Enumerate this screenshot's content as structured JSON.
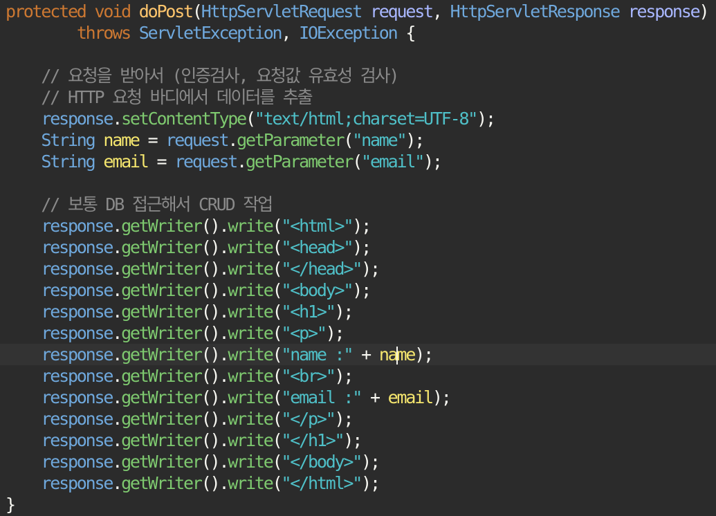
{
  "editor": {
    "colors": {
      "background": "#2b2b2b",
      "keyword": "#cc7832",
      "method_decl": "#ffc66d",
      "type": "#6fa8dc",
      "param": "#a9b7ff",
      "comment": "#8a8a8a",
      "method": "#7ec96f",
      "string": "#4fc0c8",
      "variable": "#f5e66e"
    },
    "current_line": 16,
    "lines": [
      [
        {
          "t": "protected",
          "c": "kw"
        },
        {
          "t": " ",
          "c": "punc"
        },
        {
          "t": "void",
          "c": "kw"
        },
        {
          "t": " ",
          "c": "punc"
        },
        {
          "t": "doPost",
          "c": "method-decl"
        },
        {
          "t": "(",
          "c": "punc"
        },
        {
          "t": "HttpServletRequest",
          "c": "type"
        },
        {
          "t": " ",
          "c": "punc"
        },
        {
          "t": "request",
          "c": "param"
        },
        {
          "t": ", ",
          "c": "punc"
        },
        {
          "t": "HttpServletResponse",
          "c": "type"
        },
        {
          "t": " ",
          "c": "punc"
        },
        {
          "t": "response",
          "c": "param"
        },
        {
          "t": ")",
          "c": "punc"
        }
      ],
      [
        {
          "t": "        ",
          "c": "punc"
        },
        {
          "t": "throws",
          "c": "kw"
        },
        {
          "t": " ",
          "c": "punc"
        },
        {
          "t": "ServletException",
          "c": "type"
        },
        {
          "t": ", ",
          "c": "punc"
        },
        {
          "t": "IOException",
          "c": "type"
        },
        {
          "t": " {",
          "c": "punc"
        }
      ],
      [],
      [
        {
          "t": "    ",
          "c": "punc"
        },
        {
          "t": "// 요청을 받아서 (인증검사, 요청값 유효성 검사)",
          "c": "comment"
        }
      ],
      [
        {
          "t": "    ",
          "c": "punc"
        },
        {
          "t": "// HTTP 요청 바디에서 데이터를 추출",
          "c": "comment"
        }
      ],
      [
        {
          "t": "    ",
          "c": "punc"
        },
        {
          "t": "response",
          "c": "obj"
        },
        {
          "t": ".",
          "c": "punc"
        },
        {
          "t": "setContentType",
          "c": "method"
        },
        {
          "t": "(",
          "c": "punc"
        },
        {
          "t": "\"text/html;charset=UTF-8\"",
          "c": "string"
        },
        {
          "t": ");",
          "c": "punc"
        }
      ],
      [
        {
          "t": "    ",
          "c": "punc"
        },
        {
          "t": "String",
          "c": "type"
        },
        {
          "t": " ",
          "c": "punc"
        },
        {
          "t": "name",
          "c": "var"
        },
        {
          "t": " = ",
          "c": "op"
        },
        {
          "t": "request",
          "c": "obj"
        },
        {
          "t": ".",
          "c": "punc"
        },
        {
          "t": "getParameter",
          "c": "method"
        },
        {
          "t": "(",
          "c": "punc"
        },
        {
          "t": "\"name\"",
          "c": "string"
        },
        {
          "t": ");",
          "c": "punc"
        }
      ],
      [
        {
          "t": "    ",
          "c": "punc"
        },
        {
          "t": "String",
          "c": "type"
        },
        {
          "t": " ",
          "c": "punc"
        },
        {
          "t": "email",
          "c": "var"
        },
        {
          "t": " = ",
          "c": "op"
        },
        {
          "t": "request",
          "c": "obj"
        },
        {
          "t": ".",
          "c": "punc"
        },
        {
          "t": "getParameter",
          "c": "method"
        },
        {
          "t": "(",
          "c": "punc"
        },
        {
          "t": "\"email\"",
          "c": "string"
        },
        {
          "t": ");",
          "c": "punc"
        }
      ],
      [],
      [
        {
          "t": "    ",
          "c": "punc"
        },
        {
          "t": "// 보통 DB 접근해서 CRUD 작업",
          "c": "comment"
        }
      ],
      [
        {
          "t": "    ",
          "c": "punc"
        },
        {
          "t": "response",
          "c": "obj"
        },
        {
          "t": ".",
          "c": "punc"
        },
        {
          "t": "getWriter",
          "c": "method"
        },
        {
          "t": "().",
          "c": "punc"
        },
        {
          "t": "write",
          "c": "method"
        },
        {
          "t": "(",
          "c": "punc"
        },
        {
          "t": "\"<html>\"",
          "c": "string"
        },
        {
          "t": ");",
          "c": "punc"
        }
      ],
      [
        {
          "t": "    ",
          "c": "punc"
        },
        {
          "t": "response",
          "c": "obj"
        },
        {
          "t": ".",
          "c": "punc"
        },
        {
          "t": "getWriter",
          "c": "method"
        },
        {
          "t": "().",
          "c": "punc"
        },
        {
          "t": "write",
          "c": "method"
        },
        {
          "t": "(",
          "c": "punc"
        },
        {
          "t": "\"<head>\"",
          "c": "string"
        },
        {
          "t": ");",
          "c": "punc"
        }
      ],
      [
        {
          "t": "    ",
          "c": "punc"
        },
        {
          "t": "response",
          "c": "obj"
        },
        {
          "t": ".",
          "c": "punc"
        },
        {
          "t": "getWriter",
          "c": "method"
        },
        {
          "t": "().",
          "c": "punc"
        },
        {
          "t": "write",
          "c": "method"
        },
        {
          "t": "(",
          "c": "punc"
        },
        {
          "t": "\"</head>\"",
          "c": "string"
        },
        {
          "t": ");",
          "c": "punc"
        }
      ],
      [
        {
          "t": "    ",
          "c": "punc"
        },
        {
          "t": "response",
          "c": "obj"
        },
        {
          "t": ".",
          "c": "punc"
        },
        {
          "t": "getWriter",
          "c": "method"
        },
        {
          "t": "().",
          "c": "punc"
        },
        {
          "t": "write",
          "c": "method"
        },
        {
          "t": "(",
          "c": "punc"
        },
        {
          "t": "\"<body>\"",
          "c": "string"
        },
        {
          "t": ");",
          "c": "punc"
        }
      ],
      [
        {
          "t": "    ",
          "c": "punc"
        },
        {
          "t": "response",
          "c": "obj"
        },
        {
          "t": ".",
          "c": "punc"
        },
        {
          "t": "getWriter",
          "c": "method"
        },
        {
          "t": "().",
          "c": "punc"
        },
        {
          "t": "write",
          "c": "method"
        },
        {
          "t": "(",
          "c": "punc"
        },
        {
          "t": "\"<h1>\"",
          "c": "string"
        },
        {
          "t": ");",
          "c": "punc"
        }
      ],
      [
        {
          "t": "    ",
          "c": "punc"
        },
        {
          "t": "response",
          "c": "obj"
        },
        {
          "t": ".",
          "c": "punc"
        },
        {
          "t": "getWriter",
          "c": "method"
        },
        {
          "t": "().",
          "c": "punc"
        },
        {
          "t": "write",
          "c": "method"
        },
        {
          "t": "(",
          "c": "punc"
        },
        {
          "t": "\"<p>\"",
          "c": "string"
        },
        {
          "t": ");",
          "c": "punc"
        }
      ],
      [
        {
          "t": "    ",
          "c": "punc"
        },
        {
          "t": "response",
          "c": "obj"
        },
        {
          "t": ".",
          "c": "punc"
        },
        {
          "t": "getWriter",
          "c": "method"
        },
        {
          "t": "().",
          "c": "punc"
        },
        {
          "t": "write",
          "c": "method"
        },
        {
          "t": "(",
          "c": "punc"
        },
        {
          "t": "\"name :\"",
          "c": "string"
        },
        {
          "t": " + ",
          "c": "op"
        },
        {
          "t": "na",
          "c": "var"
        },
        {
          "t": "",
          "c": "caret"
        },
        {
          "t": "me",
          "c": "var"
        },
        {
          "t": ");",
          "c": "punc"
        }
      ],
      [
        {
          "t": "    ",
          "c": "punc"
        },
        {
          "t": "response",
          "c": "obj"
        },
        {
          "t": ".",
          "c": "punc"
        },
        {
          "t": "getWriter",
          "c": "method"
        },
        {
          "t": "().",
          "c": "punc"
        },
        {
          "t": "write",
          "c": "method"
        },
        {
          "t": "(",
          "c": "punc"
        },
        {
          "t": "\"<br>\"",
          "c": "string"
        },
        {
          "t": ");",
          "c": "punc"
        }
      ],
      [
        {
          "t": "    ",
          "c": "punc"
        },
        {
          "t": "response",
          "c": "obj"
        },
        {
          "t": ".",
          "c": "punc"
        },
        {
          "t": "getWriter",
          "c": "method"
        },
        {
          "t": "().",
          "c": "punc"
        },
        {
          "t": "write",
          "c": "method"
        },
        {
          "t": "(",
          "c": "punc"
        },
        {
          "t": "\"email :\"",
          "c": "string"
        },
        {
          "t": " + ",
          "c": "op"
        },
        {
          "t": "email",
          "c": "var"
        },
        {
          "t": ");",
          "c": "punc"
        }
      ],
      [
        {
          "t": "    ",
          "c": "punc"
        },
        {
          "t": "response",
          "c": "obj"
        },
        {
          "t": ".",
          "c": "punc"
        },
        {
          "t": "getWriter",
          "c": "method"
        },
        {
          "t": "().",
          "c": "punc"
        },
        {
          "t": "write",
          "c": "method"
        },
        {
          "t": "(",
          "c": "punc"
        },
        {
          "t": "\"</p>\"",
          "c": "string"
        },
        {
          "t": ");",
          "c": "punc"
        }
      ],
      [
        {
          "t": "    ",
          "c": "punc"
        },
        {
          "t": "response",
          "c": "obj"
        },
        {
          "t": ".",
          "c": "punc"
        },
        {
          "t": "getWriter",
          "c": "method"
        },
        {
          "t": "().",
          "c": "punc"
        },
        {
          "t": "write",
          "c": "method"
        },
        {
          "t": "(",
          "c": "punc"
        },
        {
          "t": "\"</h1>\"",
          "c": "string"
        },
        {
          "t": ");",
          "c": "punc"
        }
      ],
      [
        {
          "t": "    ",
          "c": "punc"
        },
        {
          "t": "response",
          "c": "obj"
        },
        {
          "t": ".",
          "c": "punc"
        },
        {
          "t": "getWriter",
          "c": "method"
        },
        {
          "t": "().",
          "c": "punc"
        },
        {
          "t": "write",
          "c": "method"
        },
        {
          "t": "(",
          "c": "punc"
        },
        {
          "t": "\"</body>\"",
          "c": "string"
        },
        {
          "t": ");",
          "c": "punc"
        }
      ],
      [
        {
          "t": "    ",
          "c": "punc"
        },
        {
          "t": "response",
          "c": "obj"
        },
        {
          "t": ".",
          "c": "punc"
        },
        {
          "t": "getWriter",
          "c": "method"
        },
        {
          "t": "().",
          "c": "punc"
        },
        {
          "t": "write",
          "c": "method"
        },
        {
          "t": "(",
          "c": "punc"
        },
        {
          "t": "\"</html>\"",
          "c": "string"
        },
        {
          "t": ");",
          "c": "punc"
        }
      ],
      [
        {
          "t": "}",
          "c": "punc"
        }
      ]
    ]
  }
}
